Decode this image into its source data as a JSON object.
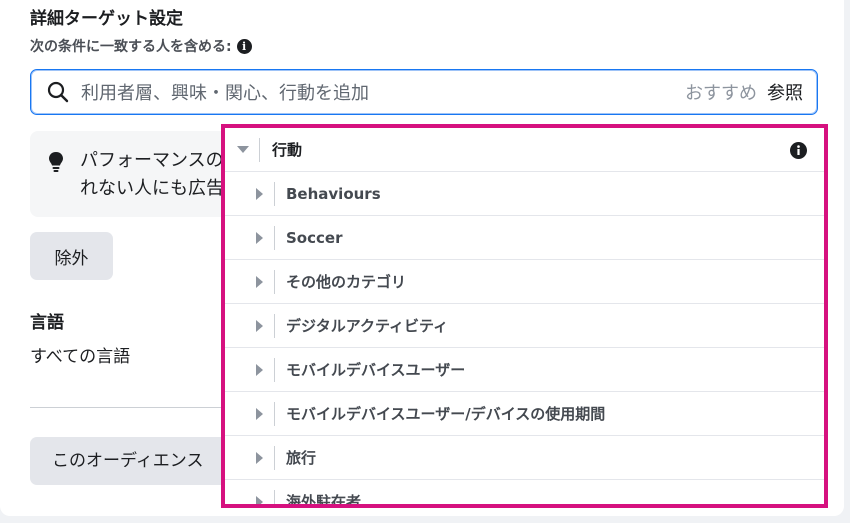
{
  "detailed_targeting": {
    "title": "詳細ターゲット設定",
    "subtitle": "次の条件に一致する人を含める:",
    "info_icon": "i"
  },
  "search": {
    "placeholder": "利用者層、興味・関心、行動を追加",
    "suggestions_label": "おすすめ",
    "browse_label": "参照"
  },
  "tip": {
    "text": "パフォーマンスの\nれない人にも広告"
  },
  "exclude_button": "除外",
  "language": {
    "title": "言語",
    "value": "すべての言語"
  },
  "audience_button": "このオーディエンス",
  "dropdown": {
    "header": "行動",
    "items": [
      {
        "label": "Behaviours"
      },
      {
        "label": "Soccer"
      },
      {
        "label": "その他のカテゴリ"
      },
      {
        "label": "デジタルアクティビティ"
      },
      {
        "label": "モバイルデバイスユーザー"
      },
      {
        "label": "モバイルデバイスユーザー/デバイスの使用期間"
      },
      {
        "label": "旅行"
      },
      {
        "label": "海外駐在者"
      }
    ]
  },
  "colors": {
    "accent_blue": "#1877f2",
    "highlight_border": "#d6117f"
  }
}
